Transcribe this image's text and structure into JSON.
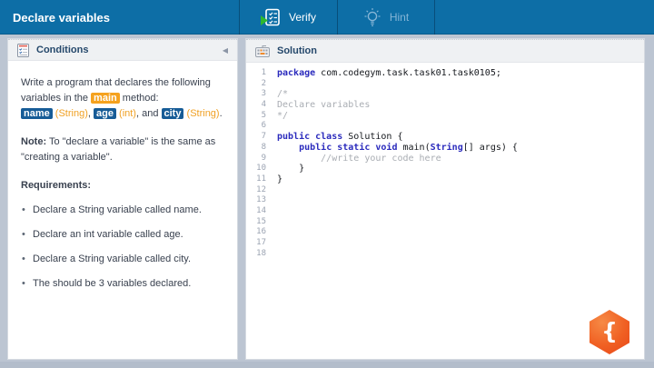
{
  "header": {
    "title": "Declare variables",
    "verify": {
      "label": "Verify"
    },
    "hint": {
      "label": "Hint"
    }
  },
  "conditions": {
    "title": "Conditions",
    "collapse_icon": "◀",
    "intro": {
      "text1": "Write a program that declares the following variables in the ",
      "main_token": "main",
      "text2": " method:",
      "var1": "name",
      "type1": " (String)",
      "sep1": ", ",
      "var2": "age",
      "type2": " (int)",
      "sep2": ", and ",
      "var3": "city",
      "type3": " (String)",
      "end": "."
    },
    "note_label": "Note:",
    "note_text": " To \"declare a variable\" is the same as \"creating a variable\".",
    "requirements_title": "Requirements:",
    "requirements": [
      "Declare a String variable called name.",
      "Declare an int variable called age.",
      "Declare a String variable called city.",
      "The should be 3 variables declared."
    ]
  },
  "solution": {
    "title": "Solution",
    "line_count": 18,
    "code_lines": [
      [
        [
          "kw",
          "package"
        ],
        [
          "p",
          " com.codegym.task.task01.task0105;"
        ]
      ],
      [],
      [
        [
          "c",
          "/*"
        ]
      ],
      [
        [
          "c",
          "Declare variables"
        ]
      ],
      [
        [
          "c",
          "*/"
        ]
      ],
      [],
      [
        [
          "kw",
          "public class"
        ],
        [
          "p",
          " Solution {"
        ]
      ],
      [
        [
          "p",
          "    "
        ],
        [
          "kw",
          "public static void"
        ],
        [
          "p",
          " main("
        ],
        [
          "kw",
          "String"
        ],
        [
          "p",
          "[] args) {"
        ]
      ],
      [
        [
          "c",
          "        //write your code here"
        ]
      ],
      [
        [
          "p",
          "    }"
        ]
      ],
      [
        [
          "p",
          "}"
        ]
      ]
    ]
  },
  "logo": {
    "glyph": "{"
  }
}
